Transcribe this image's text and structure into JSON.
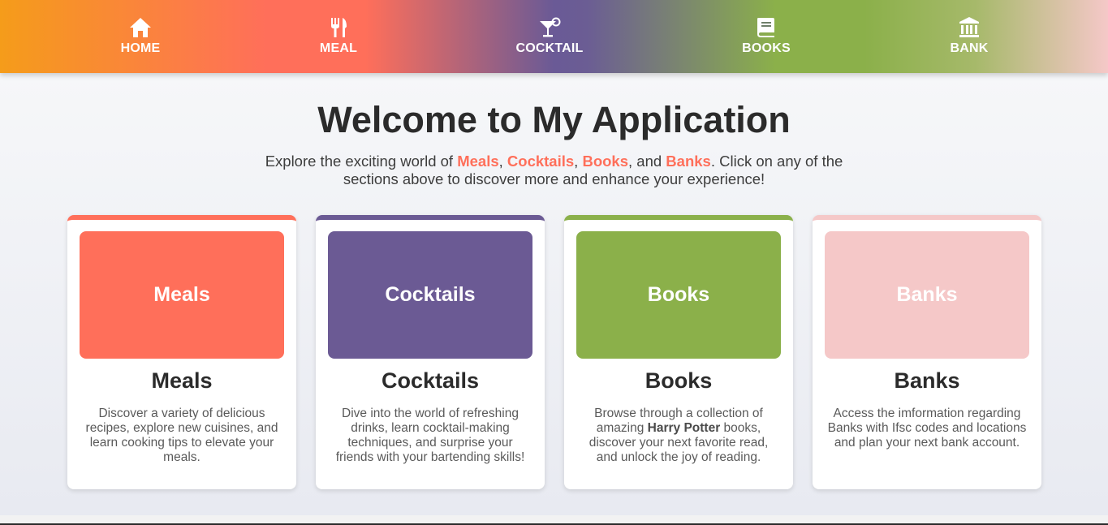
{
  "nav": {
    "items": [
      {
        "label": "HOME",
        "icon": "home-icon"
      },
      {
        "label": "MEAL",
        "icon": "utensils-icon"
      },
      {
        "label": "COCKTAIL",
        "icon": "cocktail-icon"
      },
      {
        "label": "BOOKS",
        "icon": "book-icon"
      },
      {
        "label": "BANK",
        "icon": "bank-icon"
      }
    ]
  },
  "hero": {
    "title": "Welcome to My Application",
    "intro_prefix": "Explore the exciting world of ",
    "hl_meals": "Meals",
    "sep1": ", ",
    "hl_cocktails": "Cocktails",
    "sep2": ", ",
    "hl_books": "Books",
    "sep3": ", and ",
    "hl_banks": "Banks",
    "intro_suffix": ". Click on any of the sections above to discover more and enhance your experience!"
  },
  "cards": [
    {
      "banner": "Meals",
      "title": "Meals",
      "color": "#ff6f5a",
      "desc": "Discover a variety of delicious recipes, explore new cuisines, and learn cooking tips to elevate your meals."
    },
    {
      "banner": "Cocktails",
      "title": "Cocktails",
      "color": "#6b5a94",
      "desc": "Dive into the world of refreshing drinks, learn cocktail-making techniques, and surprise your friends with your bartending skills!"
    },
    {
      "banner": "Books",
      "title": "Books",
      "color": "#8bb04a",
      "desc_prefix": "Browse through a collection of amazing ",
      "desc_bold": "Harry Potter",
      "desc_suffix": " books, discover your next favorite read, and unlock the joy of reading."
    },
    {
      "banner": "Banks",
      "title": "Banks",
      "color": "#f5c8c8",
      "desc": "Access the imformation regarding Banks with Ifsc codes and locations and plan your next bank account."
    }
  ],
  "theme": {
    "accent": "#ff6f5a",
    "text_dark": "#2b2b2b"
  }
}
